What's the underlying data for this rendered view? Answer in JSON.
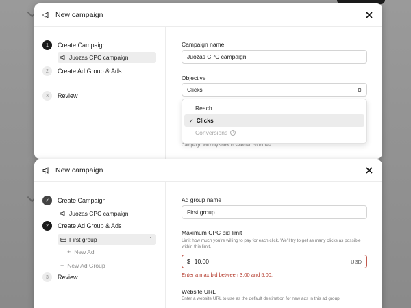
{
  "top": {
    "title": "New campaign",
    "steps": [
      {
        "num": "1",
        "label": "Create Campaign",
        "state": "active"
      },
      {
        "num": "2",
        "label": "Create Ad Group & Ads",
        "state": "inactive"
      },
      {
        "num": "3",
        "label": "Review",
        "state": "inactive"
      }
    ],
    "campaign_item": "Juozas CPC campaign",
    "campaign_name_label": "Campaign name",
    "campaign_name_value": "Juozas CPC campaign",
    "objective_label": "Objective",
    "objective_value": "Clicks",
    "objective_options": [
      {
        "label": "Reach",
        "state": "normal"
      },
      {
        "label": "Clicks",
        "state": "selected"
      },
      {
        "label": "Conversions",
        "state": "disabled"
      }
    ],
    "check_mark": "✓",
    "location_help": "Campaign will only show in selected countries."
  },
  "bottom": {
    "title": "New campaign",
    "steps": [
      {
        "num": "✓",
        "label": "Create Campaign",
        "state": "done"
      },
      {
        "num": "2",
        "label": "Create Ad Group & Ads",
        "state": "active"
      },
      {
        "num": "3",
        "label": "Review",
        "state": "inactive"
      }
    ],
    "campaign_item": "Juozas CPC campaign",
    "ad_group_item": "First group",
    "new_ad": "New Ad",
    "new_ad_group": "New Ad Group",
    "ad_group_name_label": "Ad group name",
    "ad_group_name_value": "First group",
    "max_cpc_label": "Maximum CPC bid limit",
    "max_cpc_help": "Limit how much you're willing to pay for each click. We'll try to get as many clicks as possible within this limit.",
    "bid_currency_symbol": "$",
    "bid_value": "10.00",
    "bid_currency": "USD",
    "bid_error": "Enter a max bid between 3.00 and 5.00.",
    "website_url_label": "Website URL",
    "website_url_help": "Enter a website URL to use as the default destination for new ads in this ad group."
  },
  "colors": {
    "accent": "#1a1a1a",
    "error": "#b3382a",
    "selected_bg": "#ededed"
  },
  "icons": {
    "header": "megaphone-icon",
    "close": "close-icon",
    "select": "chevron-updown-icon",
    "kebab": "more-vertical-icon",
    "info": "info-icon"
  }
}
